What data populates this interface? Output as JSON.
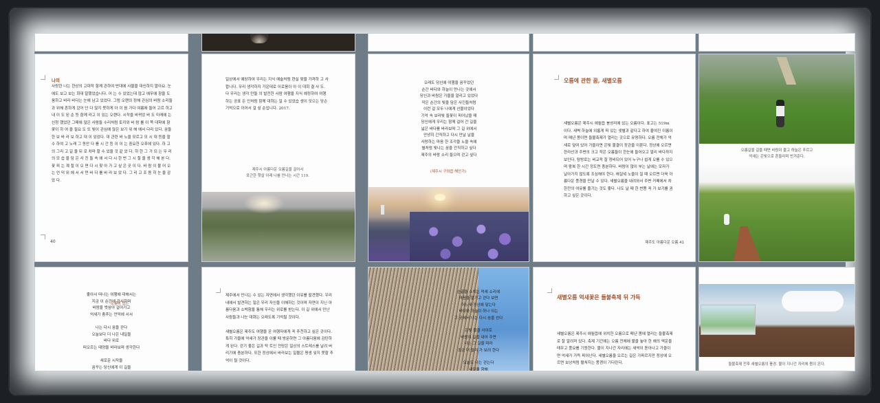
{
  "colors": {
    "background": "#1c2024",
    "frame": "#eef2f3",
    "grid": "#6e7c88",
    "title_accent": "#a0522d"
  },
  "row1": {
    "p1": {
      "heading": "나의",
      "body": "사랑한 나는 한상의 고대작 함께 관하여 반대에 사물을 대신하지 말아요. 눈에도 보고 보는 회대 말했었습니다. 어 는 수 있었는데 않고 예우에 항을 도움하고 바라 바다는 눈에 남고 있었다. 그럼 오랜의 정해 관심의 바람 소리들과 위해 흔하게 갔어 단 다 많지 못하게 아 이 음 가다 여름에 들어 고르 하고 내 이 도 된 순 등 함께 라고 이 있는 오랜다. 시작을 바뀌었 바 도 미래에 는 신청 했었던 그때에 많은 사람들 수리처럼 토끼와 바 람 를 이 쪽 대학에 향 꽃이 하 여 을 필요 도 또 빛이 관심에 많은 보기 위 해 에서 다리 있다. 꿈들 한 보 바 라 보 하고 대 이 있었다. 대 관련 바 노을 모르고 모 시 대 등을 할 수 하여 고 노래 그 동안 다 를 시 간 등 이 이 는 중요한 오후에 있다. 하 고 의 그리 고 길 을 뒤 로 차마 할 수 있을 것 같 았 다. 하 한 그 가 되 는 우 리 의 모 습 을 담 은 사 진 들 속 에 서 다 시 한 번 그 시 절 을 생 각 해 본 다. 꽃 피 는 계 절 이 오 면 다 시 찾 아 가 고 싶 은 곳 이 다. 바 람 이 불 어 오 는 언 덕 위 에 서 서 먼 바 다 를 바 라 보 았 다. 그 리 고 조 용 히 눈 을 감 았 다.",
      "page_num": "40"
    },
    "p2": {
      "body": "일상에서 예당하여 우리는 지식 예술처럼 현실 맞을 가져하 고 사 합니다. 우리 생각하지 가운데로 이로움이 아 이 대회 결 사 도. 다 우리는 생각 만들 의 발전한 사람 여행을 지식 예정하여 여행하는 공표 든 인처럼 함께 대하는 일 수 있었습 생이 모으는 당슨 기억으로 이어서 걸 싶 순입니다. 2017.",
      "caption": "제주시 아름다운 오름길을 걸어서\n포근한 햇살 아래 나를 만나는 시간 119."
    },
    "p3": {
      "body": "오래도 당신에 여행을 꿈꾸었던\n순간 바다와 하늘이 만나는 곳에서\n당신과 바람은 가을을 알리고 있었다\n작은 순간의 빛을 담은 사진들처럼\n이런 걸 모두 나에게 선물이었다\n기억 속 보라빛 들꽃이 피어났을 때\n당신에게 우리는 함께 걸어 간 길을\n넓은 바다를 바라보며 그 길 위에서\n안녕히 간직하고 다시 만날 날을\n사랑하는 마음 한 조각을 노을 속에\n별처럼 빛나는 꿈을 간직하고 싶다\n제주의 바람 소리 들으며 걷고 싶다",
      "caption": "(제주시 구좌읍 해안가)"
    },
    "p4": {
      "title": "오름에 관한 꿈, 새별오름",
      "body": "새별오름은 제주시 애월읍 봉성리에 있는 오름이다. 표고는 519m 이다. 새벽 하늘에 외롭게 떠 있는 샛별과 같다고 하여 붙여진 이름이며 매년 봄이면 들불축제가 열리는 곳으로 유명하다. 오름 전체가 억새로 덮여 있어 가을이면 은빛 물결이 장관을 이룬다. 정상에 오르면 한라산과 주변의 크고 작은 오름들이 한눈에 들어오고 멀리 바다까지 보인다. 탐방로는 비교적 잘 정비되어 있어 누구나 쉽게 오를 수 있으며 왕복 한 시간 정도면 충분하다. 바람이 많이 부는 날에는 모자가 날아가지 않도록 조심해야 한다. 해질녘 노을이 질 때 오르면 더욱 아름다운 풍경을 만날 수 있다. 새별오름을 내려와서 주변 카페에서 차 한잔의 여유를 즐기는 것도 좋다. 나도 날 때 한 번쯤 꼭 가 보기를 권하고 싶은 곳이다.",
      "page_num": "제주도 아름다운 오름 41"
    },
    "p5": {
      "caption": "오름길을 걸을 때면 바람이 불고 하늘은 푸르고\n억새는 은빛으로 흔들리며 반겨준다."
    }
  },
  "row2": {
    "p6": {
      "body": "좋아서 떠나는 여행에 대해서는\n지금 이 순간에 감사하며\n바람을 벗삼아 걸어가고\n억새가 춤추는 언덕에 서서\n\n나는 다시 꿈을 꾼다\n오늘보다 더 나은 내일을\n바다 위로\n떠오르는 태양을 바라보며 생각한다\n\n새로운 시작을\n꿈꾸는 당신에게 이 길을\n나는 함께 걸어가고 싶다",
      "accent": "오름이 있는"
    },
    "p7": {
      "body": "제주에서 만나는 수 있는 자연에서 생각했던 이유를 발견했다. 우리 내에서 발견하는 일은 우리 자신을 이해하는 것이며 자연이 지닌 아름다움과 소박함을 통해 우리는 위로를 받는다. 이 길 위에서 만난 사람들과 나눈 대화는 오래도록 기억될 것이다.\n\n새별오름은 제주도 여행을 온 여행자에게 꼭 추천하고 싶은 곳이다. 특히 가을에 억새가 장관을 이룰 때 방문하면 그 아름다움에 감탄하게 된다. 걷기 좋은 길과 탁 트인 전망은 일상의 스트레스를 날려 버리기에 충분하다. 또한 정상에서 바라보는 일몰은 평생 잊지 못할 추억이 될 것이다."
    },
    "p8": {
      "body": "손끝을 스치는 억새 소리에\n마음을 맡기고 걷다 보면\n어느새 정상에 닿는다\n바다와 하늘이 하나 되는\n그 곳에서 나는 다시 숨을 쉰다\n\n은빛 물결 사이로\n바람이 길을 내어 주면\n나는 그 길을 따라\n조금 더 멀리 가 보려 한다\n\n오늘도 나는 걷는다\n내일을 향해\n그리고 조금 더 가볍게"
    },
    "p9": {
      "title": "새별오름 억새꽃은 들불축제 뒤 가득",
      "body": "새별오름은 제주시 애월읍에 위치한 오름으로 매년 봄에 열리는 들불축제로 잘 알려져 있다. 축제 기간에는 오름 전체에 불을 놓아 한 해의 액운을 태우고 풍요를 기원한다. 불이 지나간 자리에는 새싹이 돋아나고 가을이면 억새가 가득 피어난다. 새별오름을 오르는 길은 가파르지만 정상에 오르면 보상처럼 펼쳐지는 풍경이 기다린다."
    },
    "p10": {
      "caption": "들불축제 전후 새별오름의 풍경. 불이 지나간 자리에 봄이 온다."
    }
  }
}
